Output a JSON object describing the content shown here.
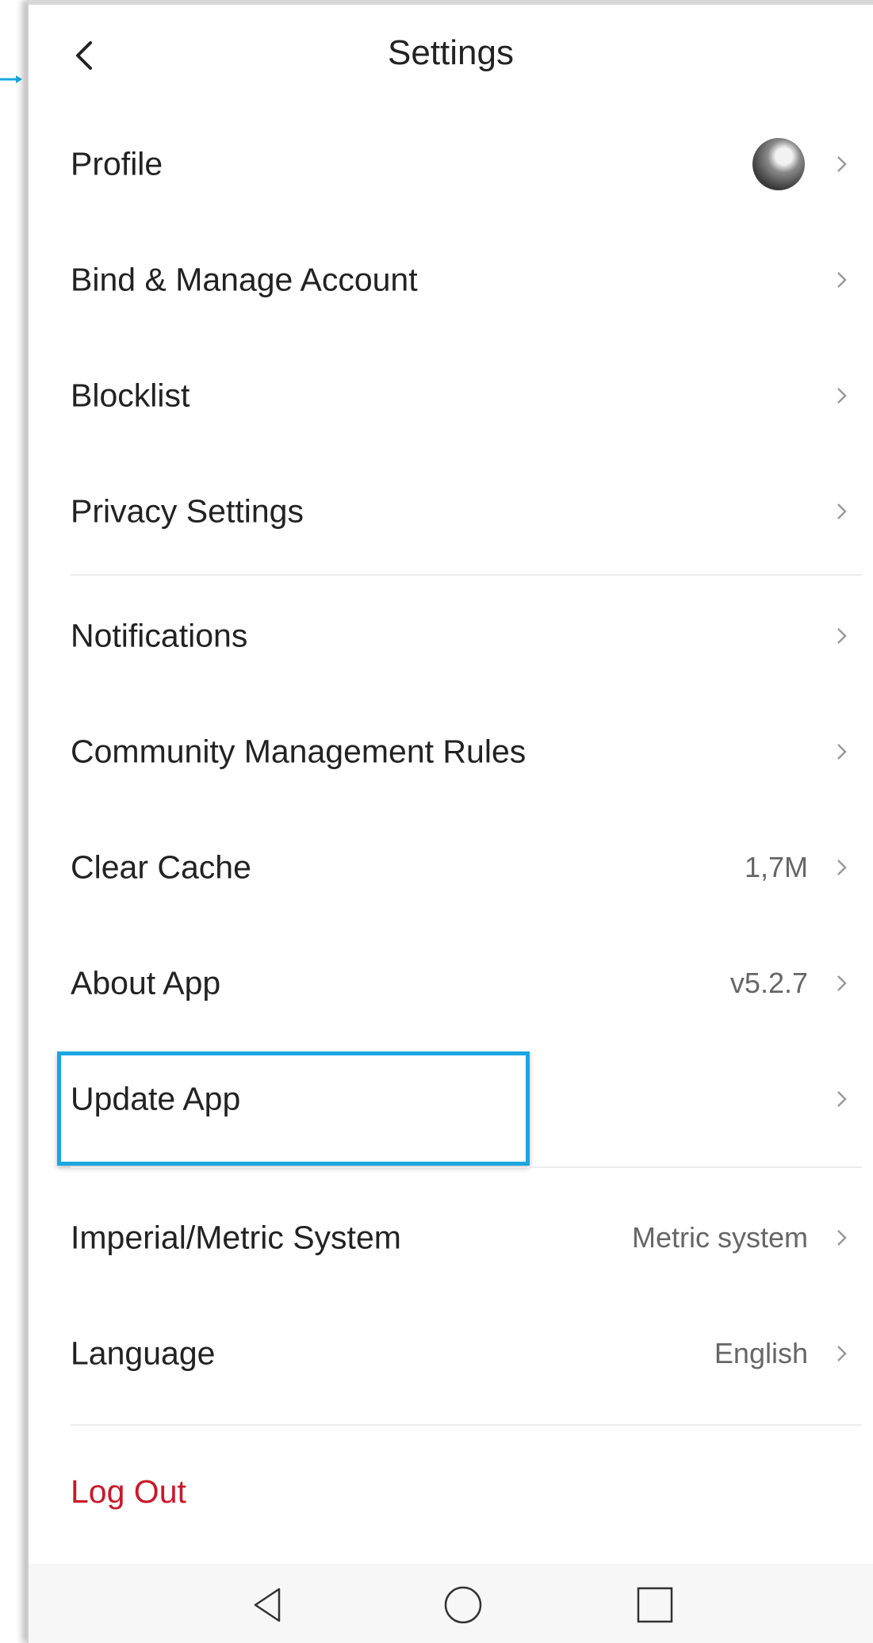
{
  "header": {
    "title": "Settings"
  },
  "rows": [
    {
      "label": "Profile",
      "value": ""
    },
    {
      "label": "Bind & Manage Account",
      "value": ""
    },
    {
      "label": "Blocklist",
      "value": ""
    },
    {
      "label": "Privacy Settings",
      "value": ""
    },
    {
      "label": "Notifications",
      "value": ""
    },
    {
      "label": "Community Management Rules",
      "value": ""
    },
    {
      "label": "Clear Cache",
      "value": "1,7M"
    },
    {
      "label": "About App",
      "value": "v5.2.7"
    },
    {
      "label": "Update App",
      "value": ""
    },
    {
      "label": "Imperial/Metric System",
      "value": "Metric system"
    },
    {
      "label": "Language",
      "value": "English"
    }
  ],
  "logout": {
    "label": "Log Out"
  },
  "colors": {
    "accent_highlight": "#1aa7e1",
    "logout": "#c8192a"
  },
  "icons": {
    "back": "chevron-left-icon",
    "chevron": "chevron-right-icon",
    "nav_back": "triangle-back-icon",
    "nav_home": "circle-home-icon",
    "nav_recents": "square-recents-icon"
  }
}
